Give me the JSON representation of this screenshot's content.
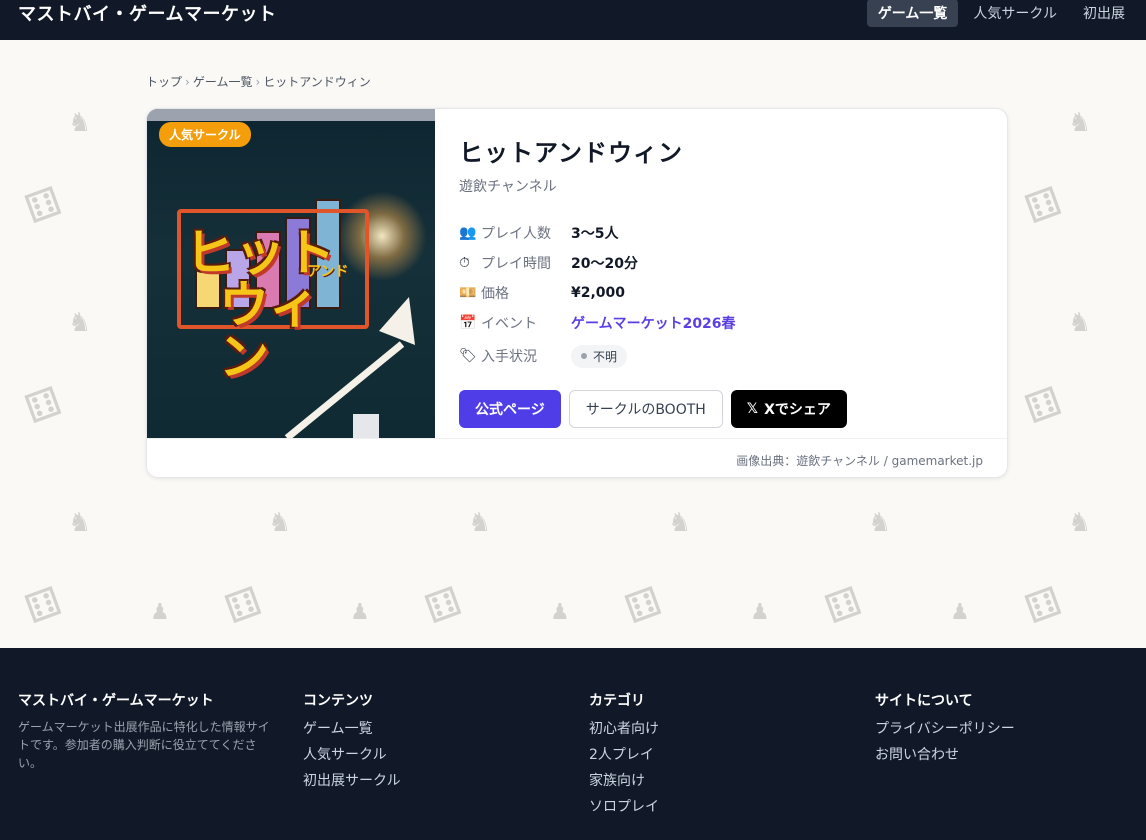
{
  "header": {
    "brand": "マストバイ・ゲームマーケット",
    "nav": [
      "ゲーム一覧",
      "人気サークル",
      "初出展"
    ]
  },
  "breadcrumb": [
    "トップ",
    "ゲーム一覧",
    "ヒットアンドウィン"
  ],
  "game": {
    "badge": "人気サークル",
    "cover_title_line1": "ヒット",
    "cover_title_line2": "ウィン",
    "cover_and": "アンド",
    "title": "ヒットアンドウィン",
    "circle": "遊飲チャンネル",
    "players_label": "プレイ人数",
    "players": "3〜5人",
    "time_label": "プレイ時間",
    "time": "20〜20分",
    "price_label": "価格",
    "price": "¥2,000",
    "event_label": "イベント",
    "event": "ゲームマーケット2026春",
    "stock_label": "入手状況",
    "stock": "不明",
    "btn_official": "公式ページ",
    "btn_booth": "サークルのBOOTH",
    "btn_x": "Xでシェア",
    "credit": "画像出典：遊飲チャンネル / gamemarket.jp"
  },
  "footer": {
    "brand": "マストバイ・ゲームマーケット",
    "description": "ゲームマーケット出展作品に特化した情報サイトです。参加者の購入判断に役立ててください。",
    "contents_title": "コンテンツ",
    "contents": [
      "ゲーム一覧",
      "人気サークル",
      "初出展サークル"
    ],
    "category_title": "カテゴリ",
    "categories": [
      "初心者向け",
      "2人プレイ",
      "家族向け",
      "ソロプレイ"
    ],
    "about_title": "サイトについて",
    "about": [
      "プライバシーポリシー",
      "お問い合わせ"
    ]
  },
  "colors": {
    "header_bg": "#111827",
    "accent": "#4f3ee8",
    "badge": "#f59e0b"
  }
}
